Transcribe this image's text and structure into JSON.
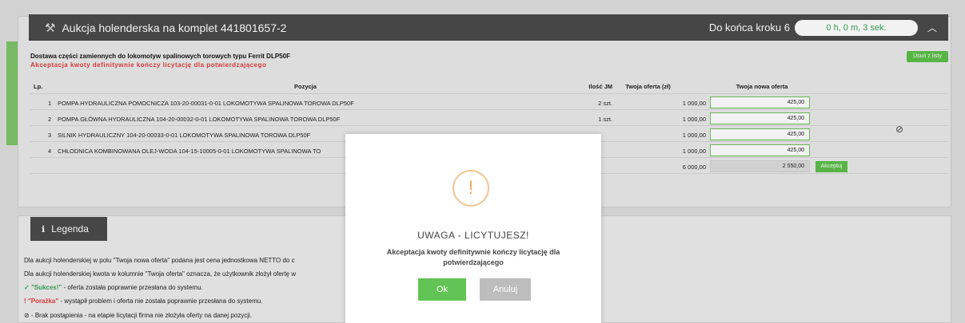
{
  "header": {
    "title": "Aukcja holenderska na komplet 441801657-2",
    "step_label": "Do końca kroku 6",
    "timer": "0 h, 0 m, 3 sek."
  },
  "subtitle": "Dostawa części zamiennych do lokomotyw spalinowych torowych typu Ferrit DLP50F",
  "warning": "Akceptacja kwoty definitywnie kończy licytację dla potwierdzającego",
  "remove_button": "Usuń z listy",
  "table": {
    "headers": [
      "Lp.",
      "Pozycja",
      "Ilość JM",
      "Twoja oferta (zł)",
      "Twoja nowa oferta"
    ],
    "rows": [
      {
        "lp": "1",
        "pozycja": "POMPA HYDRAULICZNA POMOCNICZA 103-20-00031-0-01 LOKOMOTYWA SPALINOWA TOROWA DLP50F",
        "ilosc": "2 szt.",
        "oferta": "1 000,00",
        "nowa": "425,00"
      },
      {
        "lp": "2",
        "pozycja": "POMPA GŁÓWNA HYDRAULICZNA 104-20-00032-0-01 LOKOMOTYWA SPALINOWA TOROWA DLP50F",
        "ilosc": "1 szt.",
        "oferta": "1 000,00",
        "nowa": "425,00"
      },
      {
        "lp": "3",
        "pozycja": "SILNIK HYDRAULICZNY 104-20-00033-0-01 LOKOMOTYWA SPALINOWA TOROWA DLP50F",
        "ilosc": "",
        "oferta": "1 000,00",
        "nowa": "425,00"
      },
      {
        "lp": "4",
        "pozycja": "CHŁODNICA KOMBINOWANA OLEJ-WODA 104-15-10005-0-01 LOKOMOTYWA SPALINOWA TO",
        "ilosc": "",
        "oferta": "1 000,00",
        "nowa": "425,00"
      }
    ],
    "sum_oferta": "6 000,00",
    "sum_nowa": "2 550,00",
    "accept_button": "Akceptuj"
  },
  "legend": {
    "title": "Legenda",
    "line1": "Dla aukcji holenderskiej w polu \"Twoja nowa oferta\" podana jest cena jednostkowa NETTO do c",
    "line2": "Dla aukcji holenderskiej kwota w kolumnie \"Twoja oferta\" oznacza, że użytkownik złożył ofertę w",
    "sukces_label": "\"Sukces!\"",
    "sukces_text": " - oferta została poprawnie przesłana do systemu.",
    "porazka_label": "\"Porażka\"",
    "porazka_text": " - wystąpił problem i oferta nie została poprawnie przesłana do systemu.",
    "brak_text": " - Brak postąpienia - na etapie licytacji firma nie złożyła oferty na danej pozycji."
  },
  "modal": {
    "title": "UWAGA - LICYTUJESZ!",
    "body": "Akceptacja kwoty definitywnie kończy licytację dla potwierdzającego",
    "ok": "Ok",
    "cancel": "Anuluj"
  }
}
